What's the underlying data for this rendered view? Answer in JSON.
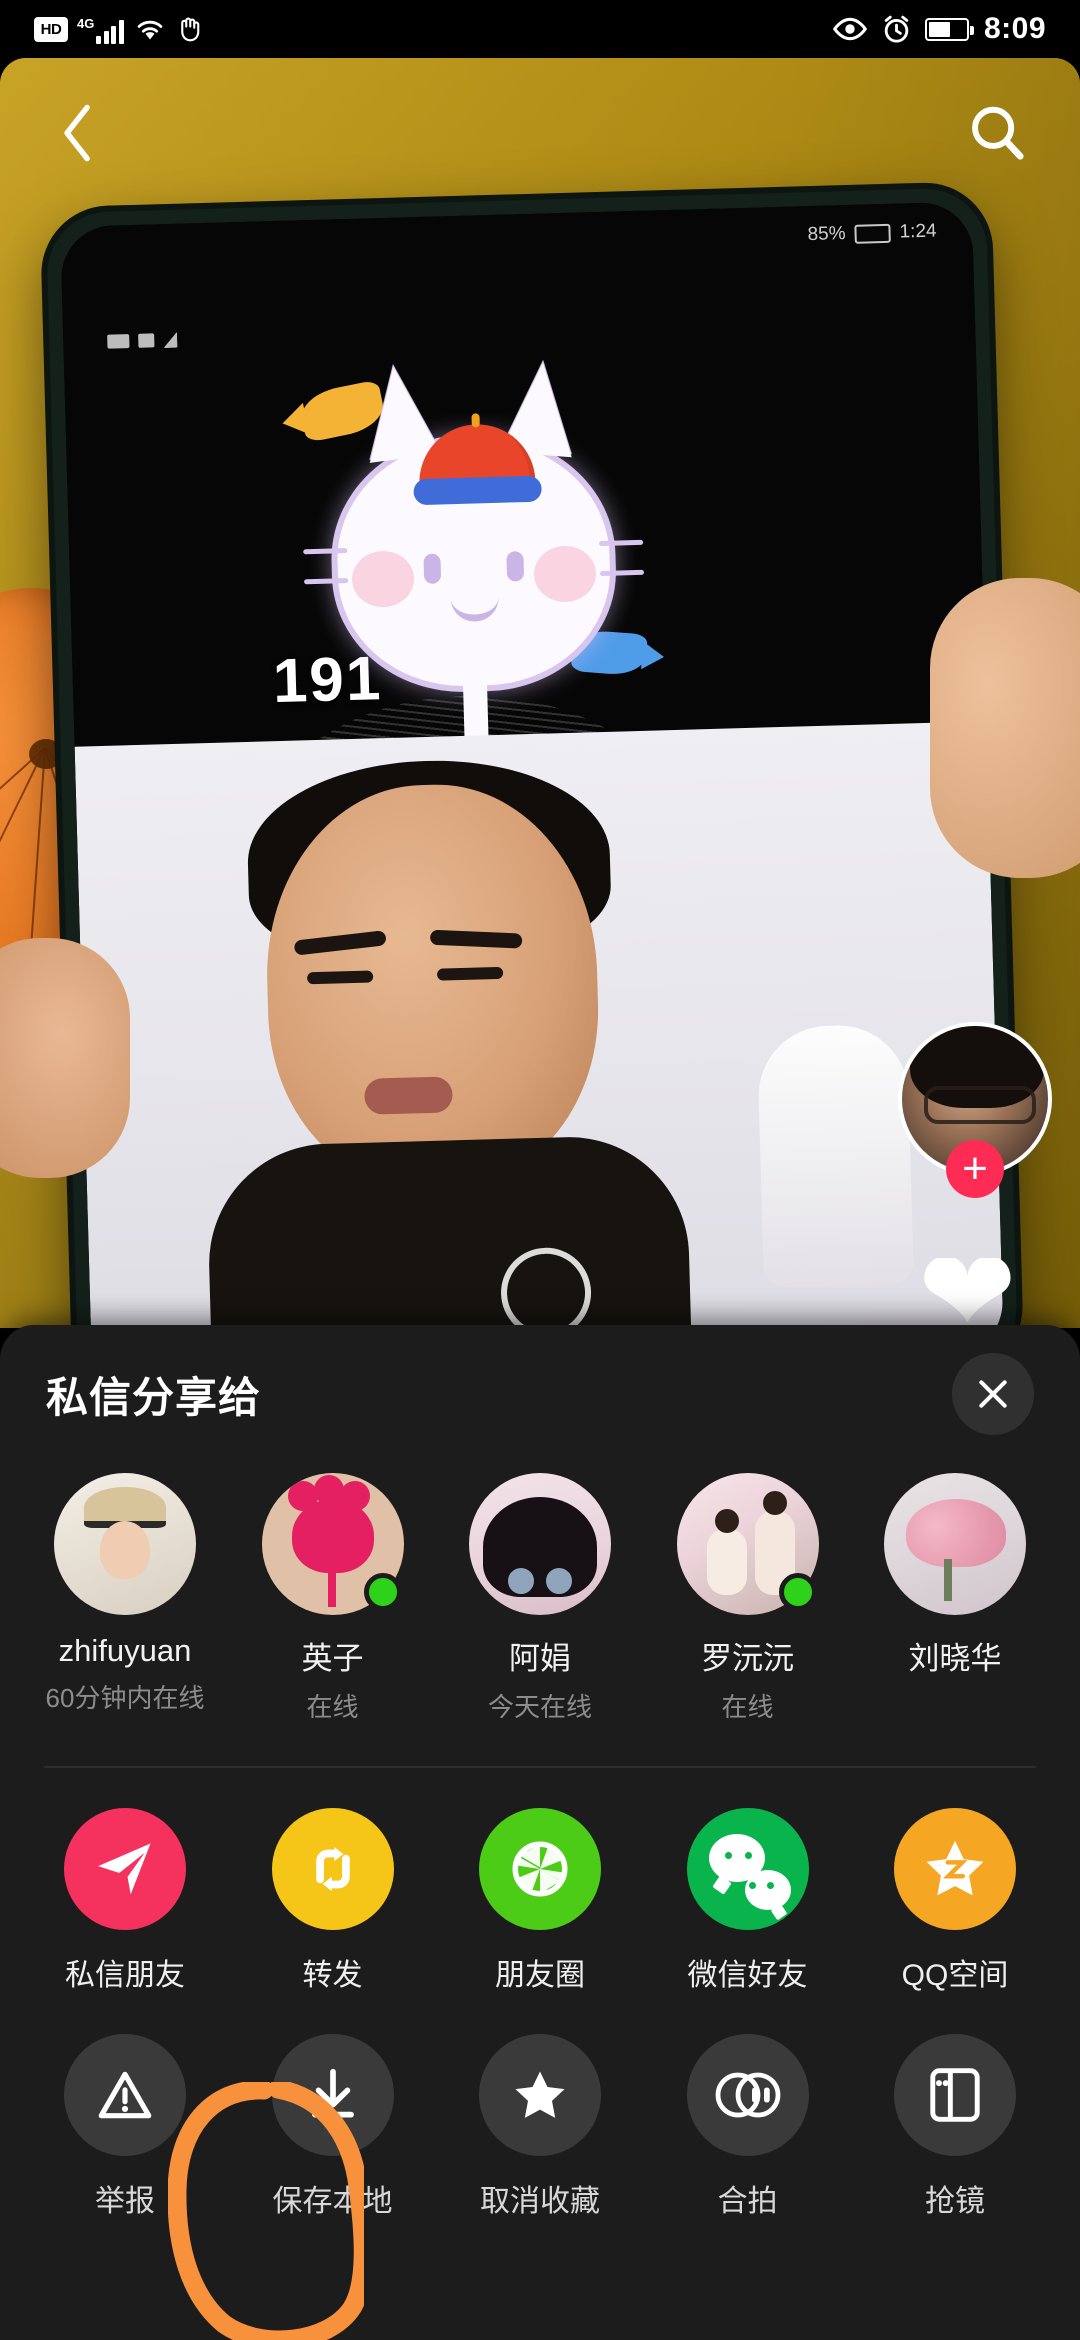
{
  "status_bar": {
    "hd_label": "HD",
    "network_label": "4G",
    "time": "8:09",
    "icons": [
      "hd-badge",
      "signal-bars-icon",
      "wifi-icon",
      "hand-icon",
      "eye-icon",
      "alarm-clock-icon",
      "battery-icon"
    ],
    "battery_level_percent": 60
  },
  "video": {
    "back_icon": "chevron-left-icon",
    "search_icon": "search-icon",
    "follow_button_label": "+",
    "like_icon": "heart-icon",
    "inner_phone": {
      "battery_text": "85%",
      "clock_text": "1:24",
      "overlay_number": "191"
    },
    "background_color": "#b8930f"
  },
  "sheet": {
    "title": "私信分享给",
    "close_icon": "close-icon",
    "background_color": "#1c1c1c",
    "contacts": [
      {
        "name": "zhifuyuan",
        "status": "60分钟内在线",
        "online": false,
        "avatar": "av1"
      },
      {
        "name": "英子",
        "status": "在线",
        "online": true,
        "avatar": "av2"
      },
      {
        "name": "阿娟",
        "status": "今天在线",
        "online": false,
        "avatar": "av3"
      },
      {
        "name": "罗沅沅",
        "status": "在线",
        "online": true,
        "avatar": "av4"
      },
      {
        "name": "刘晓华",
        "status": "",
        "online": false,
        "avatar": "av5"
      }
    ],
    "share_actions": [
      {
        "label": "私信朋友",
        "icon": "paper-plane-icon",
        "color": "#f5315e"
      },
      {
        "label": "转发",
        "icon": "repost-arrows-icon",
        "color": "#f5c518"
      },
      {
        "label": "朋友圈",
        "icon": "aperture-icon",
        "color": "#4ccc16"
      },
      {
        "label": "微信好友",
        "icon": "wechat-icon",
        "color": "#0ab44c"
      },
      {
        "label": "QQ空间",
        "icon": "qzone-star-icon",
        "color": "#f5a623"
      }
    ],
    "tool_actions": [
      {
        "label": "举报",
        "icon": "warning-triangle-icon"
      },
      {
        "label": "保存本地",
        "icon": "download-icon",
        "highlighted": true
      },
      {
        "label": "取消收藏",
        "icon": "star-icon"
      },
      {
        "label": "合拍",
        "icon": "duet-circles-icon"
      },
      {
        "label": "抢镜",
        "icon": "react-phone-icon"
      }
    ]
  },
  "annotation": {
    "shape": "hand-drawn-circle",
    "color": "#f7913c",
    "target_label": "保存本地"
  }
}
